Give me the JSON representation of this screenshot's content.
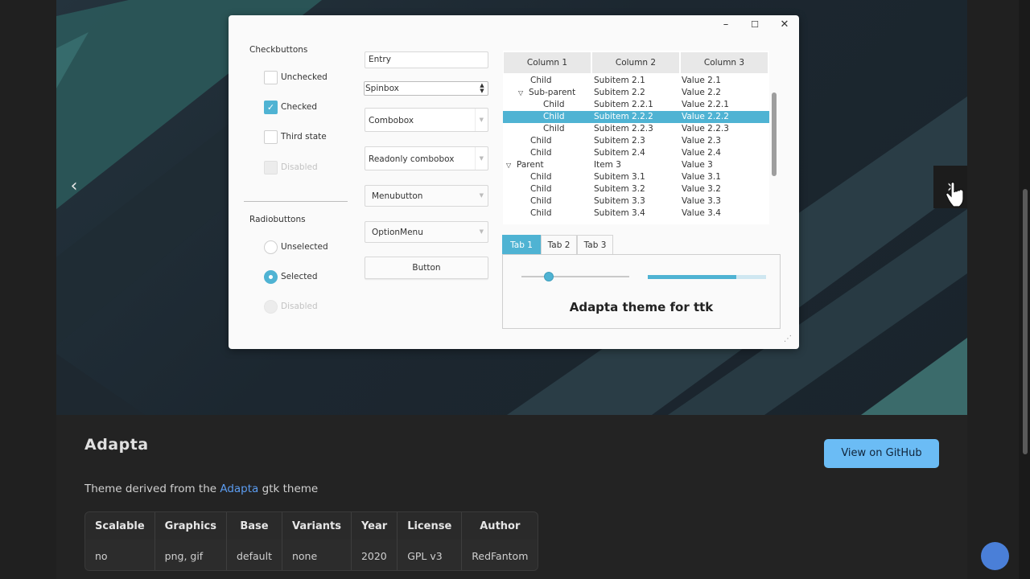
{
  "hero": {
    "prev_label": "‹",
    "next_label": "›",
    "window": {
      "controls": {
        "minimize": "–",
        "maximize": "☐",
        "close": "✕"
      },
      "checkbuttons": {
        "heading": "Checkbuttons",
        "items": [
          {
            "label": "Unchecked",
            "state": "unchecked"
          },
          {
            "label": "Checked",
            "state": "checked"
          },
          {
            "label": "Third state",
            "state": "third"
          },
          {
            "label": "Disabled",
            "state": "disabled"
          }
        ]
      },
      "radiobuttons": {
        "heading": "Radiobuttons",
        "items": [
          {
            "label": "Unselected",
            "state": "unselected"
          },
          {
            "label": "Selected",
            "state": "selected"
          },
          {
            "label": "Disabled",
            "state": "disabled"
          }
        ]
      },
      "entry_value": "Entry",
      "spinbox_value": "Spinbox",
      "combobox_value": "Combobox",
      "readonly_combobox_value": "Readonly combobox",
      "menubutton_label": "Menubutton",
      "optionmenu_label": "OptionMenu",
      "button_label": "Button",
      "tree": {
        "columns": [
          "Column 1",
          "Column 2",
          "Column 3"
        ],
        "rows": [
          {
            "c1": "Child",
            "c2": "Subitem 2.1",
            "c3": "Value 2.1",
            "indent": 1,
            "expander": ""
          },
          {
            "c1": "Sub-parent",
            "c2": "Subitem 2.2",
            "c3": "Value 2.2",
            "indent": 1,
            "expander": "▽"
          },
          {
            "c1": "Child",
            "c2": "Subitem 2.2.1",
            "c3": "Value 2.2.1",
            "indent": 2,
            "expander": ""
          },
          {
            "c1": "Child",
            "c2": "Subitem 2.2.2",
            "c3": "Value 2.2.2",
            "indent": 2,
            "expander": "",
            "selected": true
          },
          {
            "c1": "Child",
            "c2": "Subitem 2.2.3",
            "c3": "Value 2.2.3",
            "indent": 2,
            "expander": ""
          },
          {
            "c1": "Child",
            "c2": "Subitem 2.3",
            "c3": "Value 2.3",
            "indent": 1,
            "expander": ""
          },
          {
            "c1": "Child",
            "c2": "Subitem 2.4",
            "c3": "Value 2.4",
            "indent": 1,
            "expander": ""
          },
          {
            "c1": "Parent",
            "c2": "Item 3",
            "c3": "Value 3",
            "indent": 0,
            "expander": "▽"
          },
          {
            "c1": "Child",
            "c2": "Subitem 3.1",
            "c3": "Value 3.1",
            "indent": 1,
            "expander": ""
          },
          {
            "c1": "Child",
            "c2": "Subitem 3.2",
            "c3": "Value 3.2",
            "indent": 1,
            "expander": ""
          },
          {
            "c1": "Child",
            "c2": "Subitem 3.3",
            "c3": "Value 3.3",
            "indent": 1,
            "expander": ""
          },
          {
            "c1": "Child",
            "c2": "Subitem 3.4",
            "c3": "Value 3.4",
            "indent": 1,
            "expander": ""
          }
        ]
      },
      "tabs": [
        "Tab 1",
        "Tab 2",
        "Tab 3"
      ],
      "active_tab": 0,
      "scale_value": 0.25,
      "progress_value": 0.75,
      "notebook_label": "Adapta theme for ttk"
    }
  },
  "info": {
    "title": "Adapta",
    "github_button": "View on GitHub",
    "description_prefix": "Theme derived from the ",
    "description_link": "Adapta",
    "description_suffix": " gtk theme",
    "table": {
      "headers": [
        "Scalable",
        "Graphics",
        "Base",
        "Variants",
        "Year",
        "License",
        "Author"
      ],
      "values": [
        "no",
        "png, gif",
        "default",
        "none",
        "2020",
        "GPL v3",
        "RedFantom"
      ]
    }
  },
  "colors": {
    "accent": "#4fb3d3",
    "github_button": "#6bbcf5",
    "link": "#5b9cf0",
    "fab": "#4a7fd8"
  }
}
